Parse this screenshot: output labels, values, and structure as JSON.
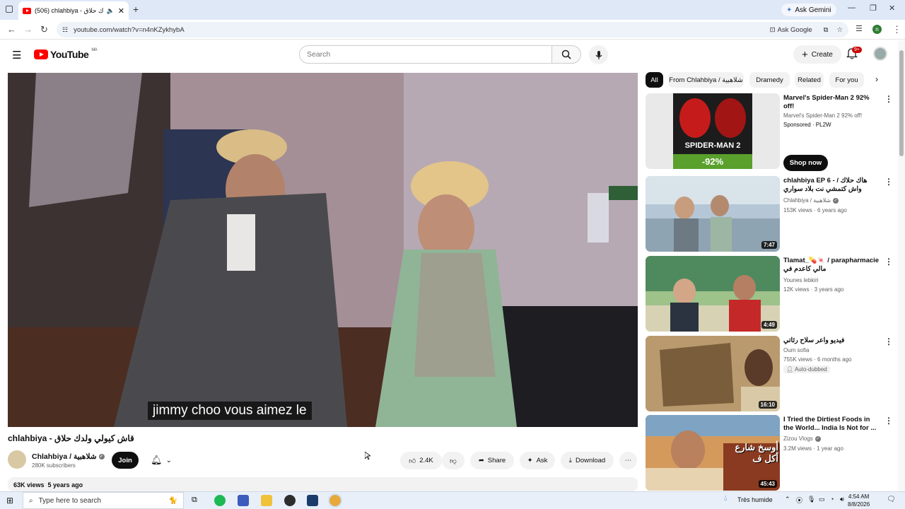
{
  "browser": {
    "tab_title": "(506) chlahbiya - قاش كيولي ولدك حلاق",
    "ask_gemini": "Ask Gemini",
    "url": "youtube.com/watch?v=n4nKZykhybA",
    "ask_google": "Ask Google"
  },
  "youtube": {
    "logo_text": "YouTube",
    "region": "MA",
    "search_placeholder": "Search",
    "create_label": "Create",
    "notification_count": "9+"
  },
  "video": {
    "caption": "jimmy choo vous aimez le",
    "title": "chlahbiya - قاش كيولي ولدك حلاق",
    "channel_name": "Chlahbiya / شلاهبية",
    "subscribers": "280K subscribers",
    "join_label": "Join",
    "likes": "2.4K",
    "share_label": "Share",
    "ask_label": "Ask",
    "download_label": "Download",
    "views": "63K views",
    "age": "5 years ago"
  },
  "chips": [
    "All",
    "From Chlahbiya / شلاهبية",
    "Dramedy",
    "Related",
    "For you"
  ],
  "recommendations": [
    {
      "title": "Marvel's Spider-Man 2 92% off!",
      "channel": "Marvel's Spider-Man 2 92% off!",
      "meta": "Sponsored · PL2W",
      "cta": "Shop now",
      "thumb_text": "SPIDER-MAN 2",
      "discount": "-92%"
    },
    {
      "title": "chlahbiya EP 6 - هاك حلاك / واش كتمشي نت بلاد سواري",
      "channel": "Chlahbiya / شلاهبية",
      "meta": "153K views · 6 years ago",
      "duration": "7:47"
    },
    {
      "title": "Tlamat_💊🍬 / parapharmacie مالي كاعدم في",
      "channel": "Younes lebkiri",
      "meta": "12K views · 3 years ago",
      "duration": "4:49"
    },
    {
      "title": "فيديو واعر سلاح رئاتي",
      "channel": "Oum sofia",
      "meta": "755K views · 6 months ago",
      "badge": "Auto-dubbed",
      "duration": "16:10"
    },
    {
      "title": "I Tried the Dirtiest Foods in the World... India Is Not for ...",
      "channel": "Zizou Vlogs",
      "meta": "3.2M views · 1 year ago",
      "duration": "45:43",
      "thumb_text": "أوسخ شارع أكل ف"
    }
  ],
  "taskbar": {
    "search_placeholder": "Type here to search",
    "weather": "Très humide",
    "time": "4:54 AM",
    "date": "8/8/2026"
  }
}
